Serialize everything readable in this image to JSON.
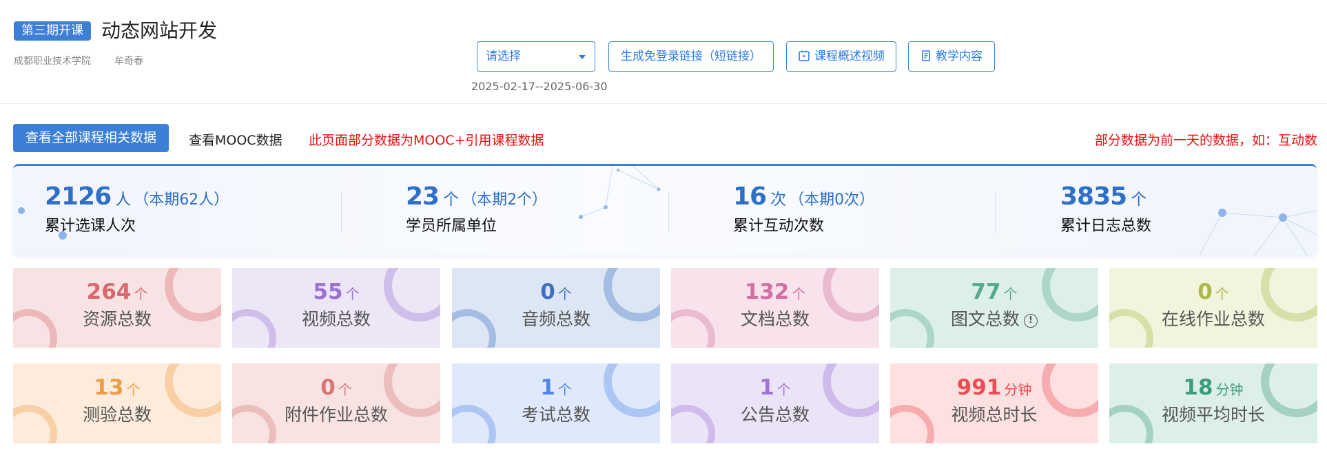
{
  "header": {
    "badge": "第三期开课",
    "course_title": "动态网站开发",
    "school": "成都职业技术学院",
    "teacher": "牟奇春",
    "select_placeholder": "请选择",
    "buttons": {
      "link": "生成免登录链接（短链接）",
      "video": "课程概述视频",
      "content": "教学内容"
    },
    "date_range": "2025-02-17--2025-06-30"
  },
  "tabs": {
    "all": "查看全部课程相关数据",
    "mooc": "查看MOOC数据",
    "note_left": "此页面部分数据为MOOC+引用课程数据",
    "note_right": "部分数据为前一天的数据，如：互动数"
  },
  "summary": [
    {
      "value": "2126",
      "unit": "人",
      "sub": "（本期62人）",
      "label": "累计选课人次"
    },
    {
      "value": "23",
      "unit": "个",
      "sub": "（本期2个）",
      "label": "学员所属单位"
    },
    {
      "value": "16",
      "unit": "次",
      "sub": "（本期0次）",
      "label": "累计互动次数"
    },
    {
      "value": "3835",
      "unit": "个",
      "sub": "",
      "label": "累计日志总数"
    }
  ],
  "cards": [
    {
      "value": "264",
      "unit": "个",
      "label": "资源总数",
      "color": "#d9686d",
      "bg": "#f7e3e4"
    },
    {
      "value": "55",
      "unit": "个",
      "label": "视频总数",
      "color": "#9b70d3",
      "bg": "#ece6f6"
    },
    {
      "value": "0",
      "unit": "个",
      "label": "音频总数",
      "color": "#3d6fc2",
      "bg": "#dde6f4"
    },
    {
      "value": "132",
      "unit": "个",
      "label": "文档总数",
      "color": "#d170a1",
      "bg": "#f8e2ec"
    },
    {
      "value": "77",
      "unit": "个",
      "label": "图文总数",
      "color": "#56a88a",
      "bg": "#dcefe8"
    },
    {
      "value": "0",
      "unit": "个",
      "label": "在线作业总数",
      "color": "#a9b848",
      "bg": "#f2f4dd"
    },
    {
      "value": "13",
      "unit": "个",
      "label": "测验总数",
      "color": "#f19a45",
      "bg": "#fdecdb"
    },
    {
      "value": "0",
      "unit": "个",
      "label": "附件作业总数",
      "color": "#d77773",
      "bg": "#f8e3e2"
    },
    {
      "value": "1",
      "unit": "个",
      "label": "考试总数",
      "color": "#4f86e6",
      "bg": "#dfe9fb"
    },
    {
      "value": "1",
      "unit": "个",
      "label": "公告总数",
      "color": "#9d74d6",
      "bg": "#ebe4f7"
    },
    {
      "value": "991",
      "unit": "分钟",
      "label": "视频总时长",
      "color": "#ec4d52",
      "bg": "#fde1e1"
    },
    {
      "value": "18",
      "unit": "分钟",
      "label": "视频平均时长",
      "color": "#3d9c7e",
      "bg": "#ddefe9"
    }
  ]
}
